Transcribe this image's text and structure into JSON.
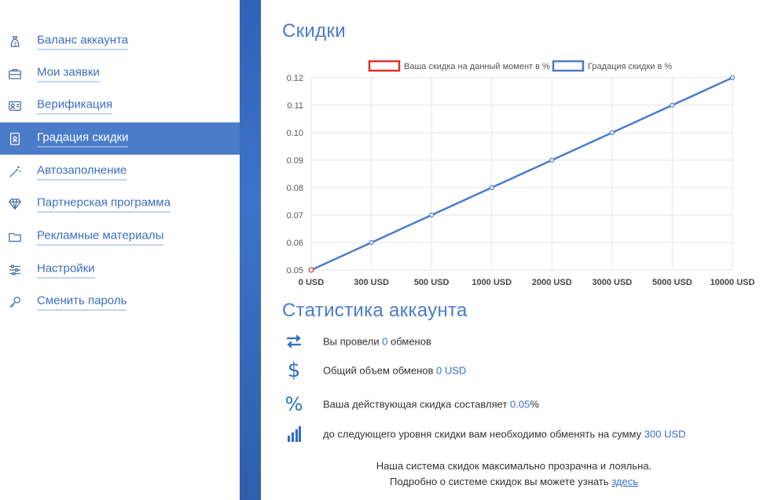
{
  "sidebar": {
    "items": [
      {
        "label": "Баланс аккаунта",
        "icon": "money-bag-icon",
        "active": false
      },
      {
        "label": "Мои заявки",
        "icon": "briefcase-icon",
        "active": false
      },
      {
        "label": "Верификация",
        "icon": "id-card-icon",
        "active": false
      },
      {
        "label": "Градация скидки",
        "icon": "badge-icon",
        "active": true
      },
      {
        "label": "Автозаполнение",
        "icon": "magic-wand-icon",
        "active": false
      },
      {
        "label": "Партнерская программа",
        "icon": "diamond-icon",
        "active": false
      },
      {
        "label": "Рекламные материалы",
        "icon": "folder-icon",
        "active": false
      },
      {
        "label": "Настройки",
        "icon": "sliders-icon",
        "active": false
      },
      {
        "label": "Сменить пароль",
        "icon": "key-icon",
        "active": false
      }
    ]
  },
  "discounts": {
    "title": "Скидки"
  },
  "chart_data": {
    "type": "line",
    "categories": [
      "0 USD",
      "300 USD",
      "500 USD",
      "1000 USD",
      "2000 USD",
      "3000 USD",
      "5000 USD",
      "10000 USD"
    ],
    "series": [
      {
        "name": "Ваша скидка на данный момент в %",
        "color": "#e0302a",
        "values": [
          0.05
        ]
      },
      {
        "name": "Градация скидки в %",
        "color": "#4a7cc9",
        "values": [
          0.05,
          0.06,
          0.07,
          0.08,
          0.09,
          0.1,
          0.11,
          0.12
        ]
      }
    ],
    "y_ticks": [
      "0.05",
      "0.06",
      "0.07",
      "0.08",
      "0.09",
      "0.10",
      "0.11",
      "0.12"
    ],
    "ylim": [
      0.05,
      0.12
    ],
    "grid": true,
    "legend": "top"
  },
  "stats": {
    "title": "Статистика аккаунта",
    "rows": [
      {
        "icon": "exchange-arrows-icon",
        "prefix": "Вы провели ",
        "value": "0",
        "suffix": " обменов"
      },
      {
        "icon": "dollar-icon",
        "prefix": "Общий объем обменов ",
        "value": "0 USD",
        "suffix": ""
      },
      {
        "icon": "percent-icon",
        "prefix": "Ваша действующая скидка составляет ",
        "value": "0.05",
        "suffix": "%"
      },
      {
        "icon": "bar-chart-icon",
        "prefix": "до следующего уровня скидки вам необходимо обменять на сумму ",
        "value": "300 USD",
        "suffix": ""
      }
    ]
  },
  "footer": {
    "line1": "Наша система скидок максимально прозрачна и лояльна.",
    "line2_prefix": "Подробно о системе скидок вы можете узнать ",
    "link": "здесь"
  },
  "colors": {
    "accent": "#4a7cc9",
    "current_discount": "#e0302a"
  }
}
